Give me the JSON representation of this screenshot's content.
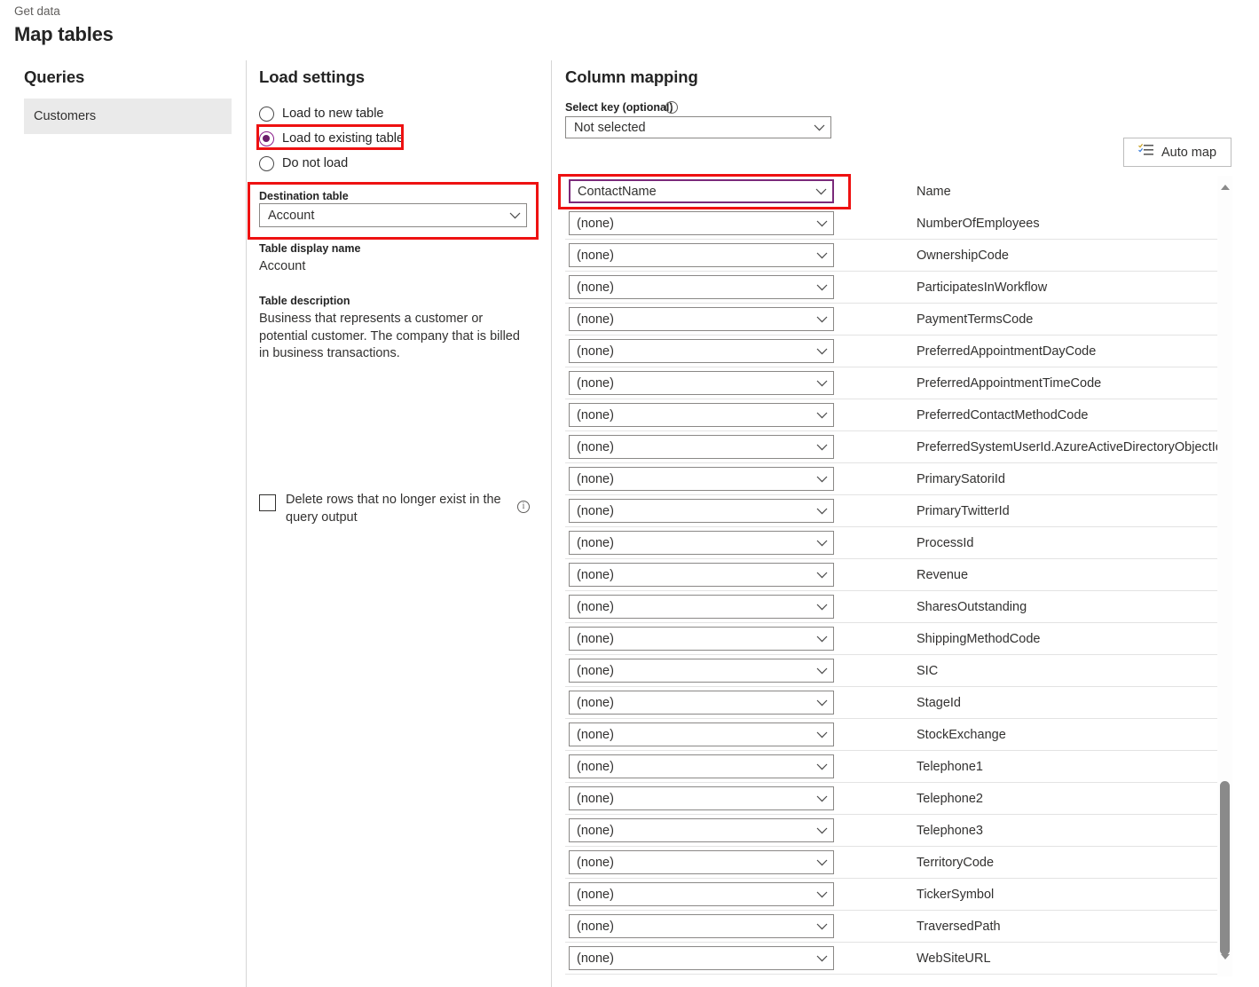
{
  "header": {
    "breadcrumb": "Get data",
    "title": "Map tables"
  },
  "queries": {
    "heading": "Queries",
    "items": [
      {
        "label": "Customers",
        "selected": true
      }
    ]
  },
  "load_settings": {
    "heading": "Load settings",
    "options": [
      {
        "label": "Load to new table",
        "selected": false
      },
      {
        "label": "Load to existing table",
        "selected": true
      },
      {
        "label": "Do not load",
        "selected": false
      }
    ],
    "destination_table": {
      "label": "Destination table",
      "value": "Account"
    },
    "table_display_name": {
      "label": "Table display name",
      "value": "Account"
    },
    "table_description": {
      "label": "Table description",
      "value": "Business that represents a customer or potential customer. The company that is billed in business transactions."
    },
    "delete_rows": {
      "label": "Delete rows that no longer exist in the query output",
      "checked": false,
      "info_icon": "info-icon"
    }
  },
  "column_mapping": {
    "heading": "Column mapping",
    "select_key": {
      "label": "Select key (optional)",
      "value": "Not selected",
      "info_icon": "info-icon"
    },
    "auto_map": {
      "label": "Auto map",
      "icon": "auto-map-list-icon"
    },
    "none_value": "(none)",
    "rows": [
      {
        "source": "ContactName",
        "target": "Name",
        "highlighted": true
      },
      {
        "source": "(none)",
        "target": "NumberOfEmployees",
        "highlighted": false
      },
      {
        "source": "(none)",
        "target": "OwnershipCode",
        "highlighted": false
      },
      {
        "source": "(none)",
        "target": "ParticipatesInWorkflow",
        "highlighted": false
      },
      {
        "source": "(none)",
        "target": "PaymentTermsCode",
        "highlighted": false
      },
      {
        "source": "(none)",
        "target": "PreferredAppointmentDayCode",
        "highlighted": false
      },
      {
        "source": "(none)",
        "target": "PreferredAppointmentTimeCode",
        "highlighted": false
      },
      {
        "source": "(none)",
        "target": "PreferredContactMethodCode",
        "highlighted": false
      },
      {
        "source": "(none)",
        "target": "PreferredSystemUserId.AzureActiveDirectoryObjectId",
        "highlighted": false
      },
      {
        "source": "(none)",
        "target": "PrimarySatoriId",
        "highlighted": false
      },
      {
        "source": "(none)",
        "target": "PrimaryTwitterId",
        "highlighted": false
      },
      {
        "source": "(none)",
        "target": "ProcessId",
        "highlighted": false
      },
      {
        "source": "(none)",
        "target": "Revenue",
        "highlighted": false
      },
      {
        "source": "(none)",
        "target": "SharesOutstanding",
        "highlighted": false
      },
      {
        "source": "(none)",
        "target": "ShippingMethodCode",
        "highlighted": false
      },
      {
        "source": "(none)",
        "target": "SIC",
        "highlighted": false
      },
      {
        "source": "(none)",
        "target": "StageId",
        "highlighted": false
      },
      {
        "source": "(none)",
        "target": "StockExchange",
        "highlighted": false
      },
      {
        "source": "(none)",
        "target": "Telephone1",
        "highlighted": false
      },
      {
        "source": "(none)",
        "target": "Telephone2",
        "highlighted": false
      },
      {
        "source": "(none)",
        "target": "Telephone3",
        "highlighted": false
      },
      {
        "source": "(none)",
        "target": "TerritoryCode",
        "highlighted": false
      },
      {
        "source": "(none)",
        "target": "TickerSymbol",
        "highlighted": false
      },
      {
        "source": "(none)",
        "target": "TraversedPath",
        "highlighted": false
      },
      {
        "source": "(none)",
        "target": "WebSiteURL",
        "highlighted": false
      }
    ],
    "scrollbar": {
      "up_arrow": "scroll-up-arrow-icon",
      "down_arrow": "scroll-down-arrow-icon"
    }
  },
  "colors": {
    "annotation": "#ee1111",
    "accent_purple": "#6b1d6b",
    "selection_bg": "#eaeaea"
  }
}
